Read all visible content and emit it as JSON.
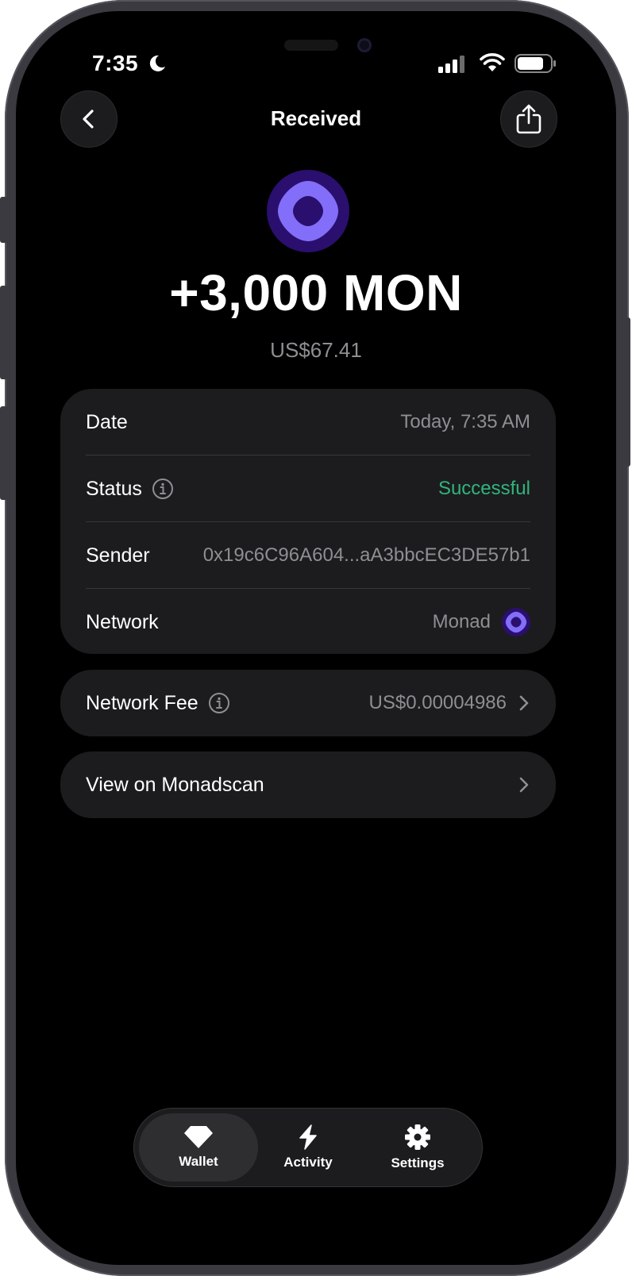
{
  "status_bar": {
    "time": "7:35"
  },
  "header": {
    "title": "Received"
  },
  "transaction": {
    "amount": "+3,000 MON",
    "fiat_value": "US$67.41"
  },
  "details": {
    "date": {
      "label": "Date",
      "value": "Today, 7:35 AM"
    },
    "status": {
      "label": "Status",
      "value": "Successful"
    },
    "sender": {
      "label": "Sender",
      "value": "0x19c6C96A604...aA3bbcEC3DE57b1"
    },
    "network": {
      "label": "Network",
      "value": "Monad"
    }
  },
  "fee": {
    "label": "Network Fee",
    "value": "US$0.00004986"
  },
  "explorer": {
    "label": "View on Monadscan"
  },
  "tabs": [
    {
      "label": "Wallet",
      "icon": "diamond-icon",
      "active": true
    },
    {
      "label": "Activity",
      "icon": "lightning-icon",
      "active": false
    },
    {
      "label": "Settings",
      "icon": "gear-icon",
      "active": false
    }
  ],
  "colors": {
    "background": "#000000",
    "card": "#1c1c1e",
    "success": "#30b57c",
    "monad_purple": "#836ef9",
    "monad_dark": "#2a0f6e"
  }
}
